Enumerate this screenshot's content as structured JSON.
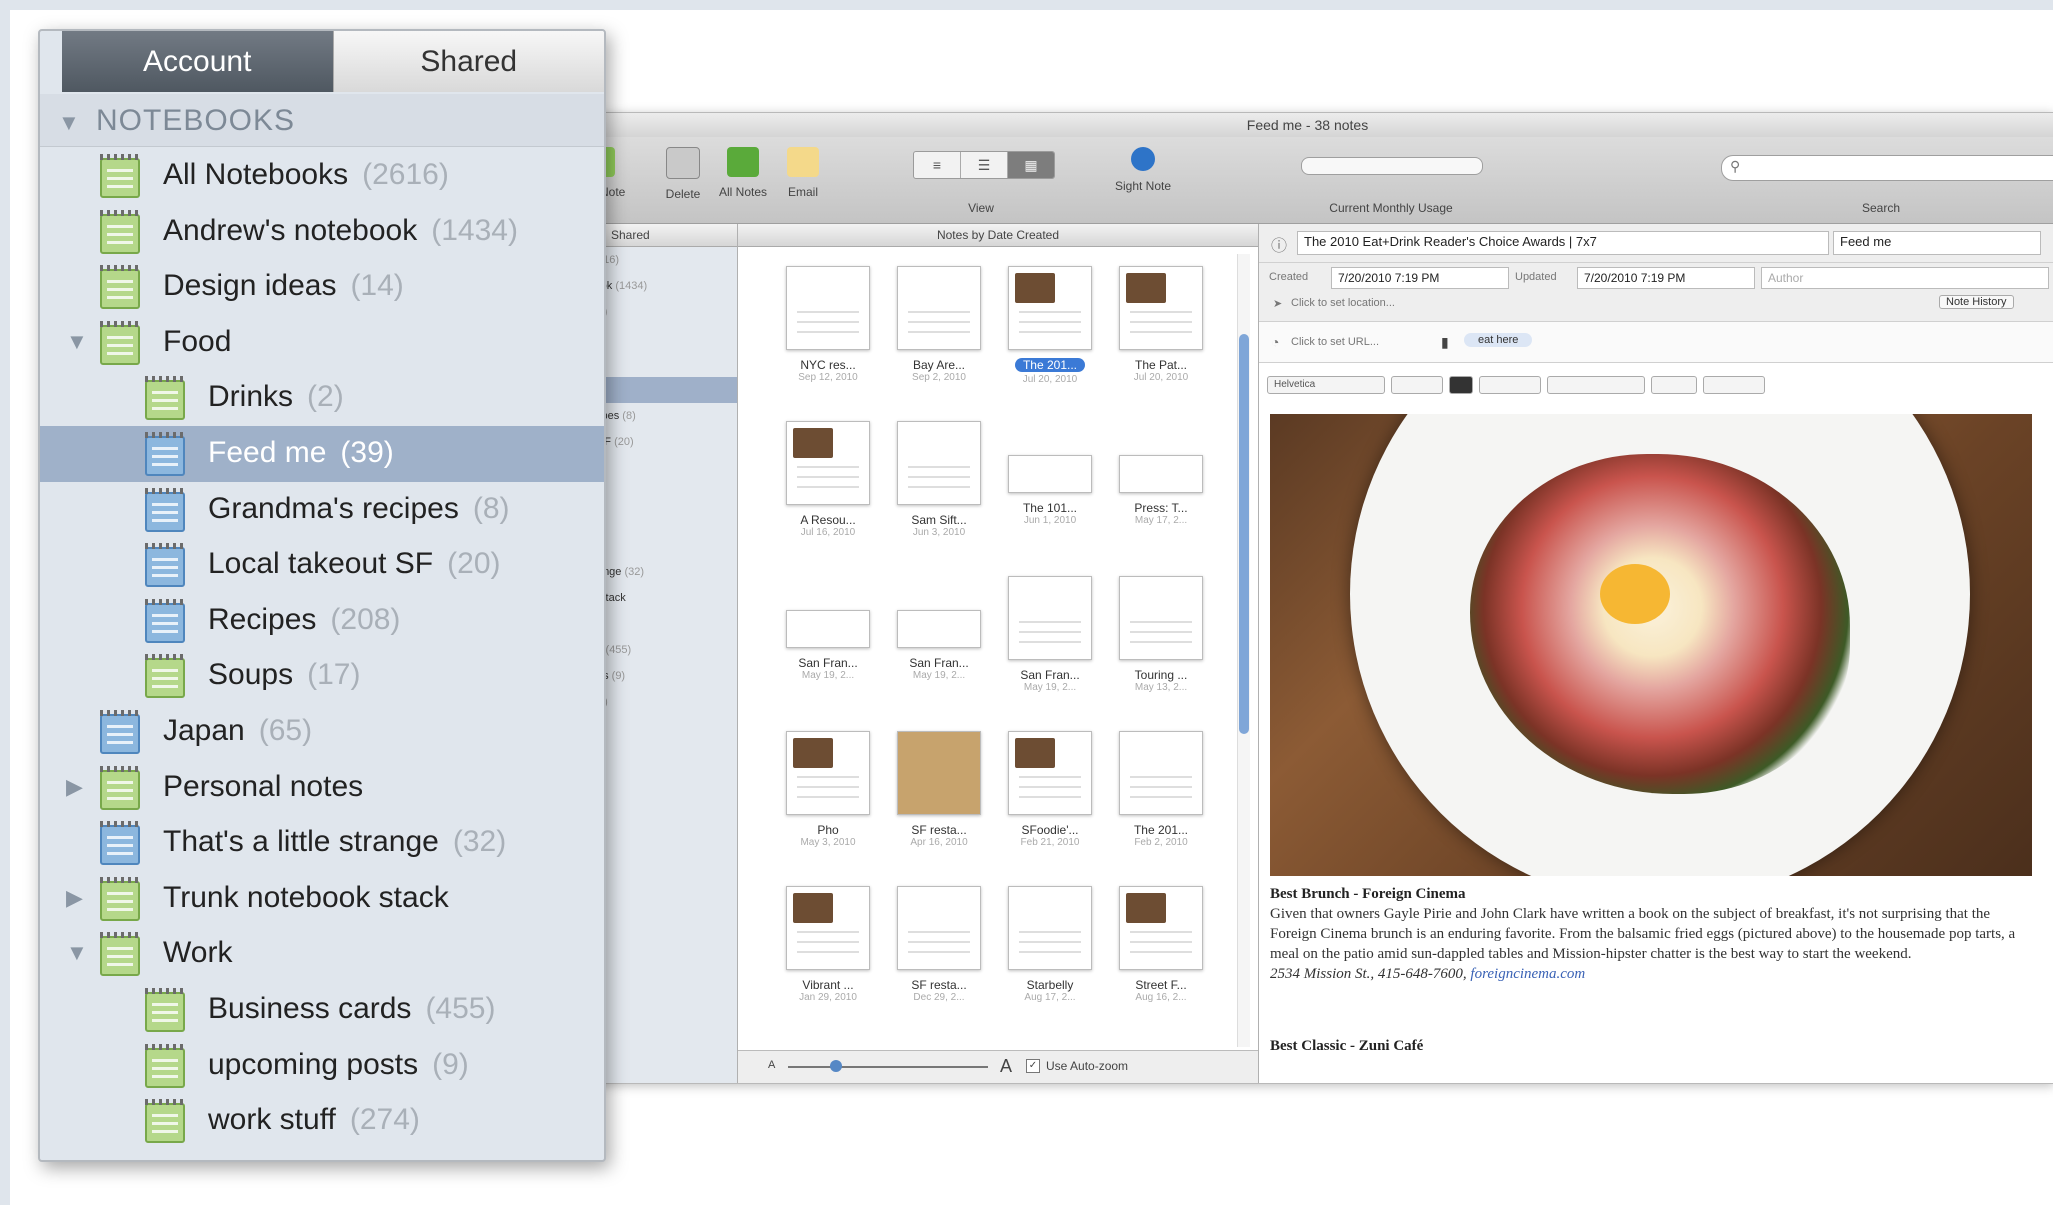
{
  "popover": {
    "tabs": [
      {
        "label": "Account",
        "active": true
      },
      {
        "label": "Shared",
        "active": false
      }
    ],
    "section_label": "NOTEBOOKS",
    "notebooks": [
      {
        "name": "All Notebooks",
        "count": "(2616)",
        "level": 0,
        "disclosure": "",
        "color": "green",
        "selected": false
      },
      {
        "name": "Andrew's notebook",
        "count": "(1434)",
        "level": 0,
        "disclosure": "",
        "color": "green",
        "selected": false
      },
      {
        "name": "Design ideas",
        "count": "(14)",
        "level": 0,
        "disclosure": "",
        "color": "green",
        "selected": false
      },
      {
        "name": "Food",
        "count": "",
        "level": 0,
        "disclosure": "▼",
        "color": "green",
        "selected": false
      },
      {
        "name": "Drinks",
        "count": "(2)",
        "level": 1,
        "disclosure": "",
        "color": "green",
        "selected": false
      },
      {
        "name": "Feed me",
        "count": "(39)",
        "level": 1,
        "disclosure": "",
        "color": "blue",
        "selected": true
      },
      {
        "name": "Grandma's recipes",
        "count": "(8)",
        "level": 1,
        "disclosure": "",
        "color": "blue",
        "selected": false
      },
      {
        "name": "Local takeout SF",
        "count": "(20)",
        "level": 1,
        "disclosure": "",
        "color": "blue",
        "selected": false
      },
      {
        "name": "Recipes",
        "count": "(208)",
        "level": 1,
        "disclosure": "",
        "color": "blue",
        "selected": false
      },
      {
        "name": "Soups",
        "count": "(17)",
        "level": 1,
        "disclosure": "",
        "color": "green",
        "selected": false
      },
      {
        "name": "Japan",
        "count": "(65)",
        "level": 0,
        "disclosure": "",
        "color": "blue",
        "selected": false
      },
      {
        "name": "Personal notes",
        "count": "",
        "level": 0,
        "disclosure": "▶",
        "color": "green",
        "selected": false
      },
      {
        "name": "That's a little strange",
        "count": "(32)",
        "level": 0,
        "disclosure": "",
        "color": "blue",
        "selected": false
      },
      {
        "name": "Trunk notebook stack",
        "count": "",
        "level": 0,
        "disclosure": "▶",
        "color": "green",
        "selected": false
      },
      {
        "name": "Work",
        "count": "",
        "level": 0,
        "disclosure": "▼",
        "color": "green",
        "selected": false
      },
      {
        "name": "Business cards",
        "count": "(455)",
        "level": 1,
        "disclosure": "",
        "color": "green",
        "selected": false
      },
      {
        "name": "upcoming posts",
        "count": "(9)",
        "level": 1,
        "disclosure": "",
        "color": "green",
        "selected": false
      },
      {
        "name": "work stuff",
        "count": "(274)",
        "level": 1,
        "disclosure": "",
        "color": "green",
        "selected": false
      }
    ]
  },
  "window": {
    "title": "Feed me - 38 notes",
    "toolbar": {
      "new_note": "New Note",
      "delete": "Delete",
      "all_notes": "All Notes",
      "email": "Email",
      "view": "View",
      "sight_note": "Sight Note",
      "usage": "Current Monthly Usage",
      "search": "Search"
    },
    "left_header": "Shared",
    "left_rows": [
      {
        "text": "oks",
        "count": "(2616)"
      },
      {
        "text": "notebook",
        "count": "(1434)"
      },
      {
        "text": "eas",
        "count": "(14)"
      },
      {
        "text": "",
        "count": ""
      },
      {
        "text": "",
        "count": "(2)"
      },
      {
        "text": "(39)",
        "count": "",
        "selected": true
      },
      {
        "text": "a's recipes",
        "count": "(8)"
      },
      {
        "text": "keout SF",
        "count": "(20)"
      },
      {
        "text": "s",
        "count": "(208)"
      },
      {
        "text": "(17)",
        "count": ""
      },
      {
        "text": "",
        "count": ""
      },
      {
        "text": "otes",
        "count": ""
      },
      {
        "text": "ttle strange",
        "count": "(32)"
      },
      {
        "text": "ebook stack",
        "count": ""
      },
      {
        "text": "",
        "count": ""
      },
      {
        "text": "s cards",
        "count": "(455)"
      },
      {
        "text": "ng posts",
        "count": "(9)"
      },
      {
        "text": "uff",
        "count": "(274)"
      }
    ],
    "list_header": "Notes by Date Created",
    "notes": [
      {
        "title": "NYC res...",
        "date": "Sep 12, 2010",
        "kind": "lines"
      },
      {
        "title": "Bay Are...",
        "date": "Sep 2, 2010",
        "kind": "lines"
      },
      {
        "title": "The 201...",
        "date": "Jul 20, 2010",
        "kind": "photo",
        "selected": true
      },
      {
        "title": "The Pat...",
        "date": "Jul 20, 2010",
        "kind": "photo"
      },
      {
        "title": "A Resou...",
        "date": "Jul 16, 2010",
        "kind": "photo"
      },
      {
        "title": "Sam Sift...",
        "date": "Jun 3, 2010",
        "kind": "lines"
      },
      {
        "title": "The 101...",
        "date": "Jun 1, 2010",
        "kind": "short"
      },
      {
        "title": "Press: T...",
        "date": "May 17, 2...",
        "kind": "short"
      },
      {
        "title": "San Fran...",
        "date": "May 19, 2...",
        "kind": "short"
      },
      {
        "title": "San Fran...",
        "date": "May 19, 2...",
        "kind": "short"
      },
      {
        "title": "San Fran...",
        "date": "May 19, 2...",
        "kind": "lines"
      },
      {
        "title": "Touring ...",
        "date": "May 13, 2...",
        "kind": "lines"
      },
      {
        "title": "Pho",
        "date": "May 3, 2010",
        "kind": "photo"
      },
      {
        "title": "SF resta...",
        "date": "Apr 16, 2010",
        "kind": "brown"
      },
      {
        "title": "SFoodie'...",
        "date": "Feb 21, 2010",
        "kind": "photo"
      },
      {
        "title": "The 201...",
        "date": "Feb 2, 2010",
        "kind": "lines"
      },
      {
        "title": "Vibrant ...",
        "date": "Jan 29, 2010",
        "kind": "photo"
      },
      {
        "title": "SF resta...",
        "date": "Dec 29, 2...",
        "kind": "lines"
      },
      {
        "title": "Starbelly",
        "date": "Aug 17, 2...",
        "kind": "lines"
      },
      {
        "title": "Street F...",
        "date": "Aug 16, 2...",
        "kind": "photo"
      }
    ],
    "zoom": {
      "autozoom_label": "Use Auto-zoom",
      "small_a": "A",
      "big_a": "A"
    },
    "note": {
      "title_value": "The 2010 Eat+Drink Reader's Choice Awards | 7x7",
      "notebook_value": "Feed me",
      "created_label": "Created",
      "created_value": "7/20/2010  7:19 PM",
      "updated_label": "Updated",
      "updated_value": "7/20/2010  7:19 PM",
      "author_placeholder": "Author",
      "location_placeholder": "Click to set location...",
      "history_button": "Note History",
      "url_placeholder": "Click to set URL...",
      "tag": "eat here",
      "font_value": "Helvetica",
      "body_heading": "Best Brunch - Foreign Cinema",
      "body_text": "Given that owners Gayle Pirie and John Clark have written a book on the subject of breakfast, it's not surprising that the Foreign Cinema brunch is an enduring favorite. From the balsamic fried eggs (pictured above) to the housemade pop tarts, a meal on the patio amid sun-dappled tables and Mission-hipster chatter is the best way to start the weekend.",
      "body_address": "2534 Mission St., 415-648-7600,",
      "body_link": "foreigncinema.com",
      "body_heading2": "Best Classic - Zuni Café"
    }
  }
}
